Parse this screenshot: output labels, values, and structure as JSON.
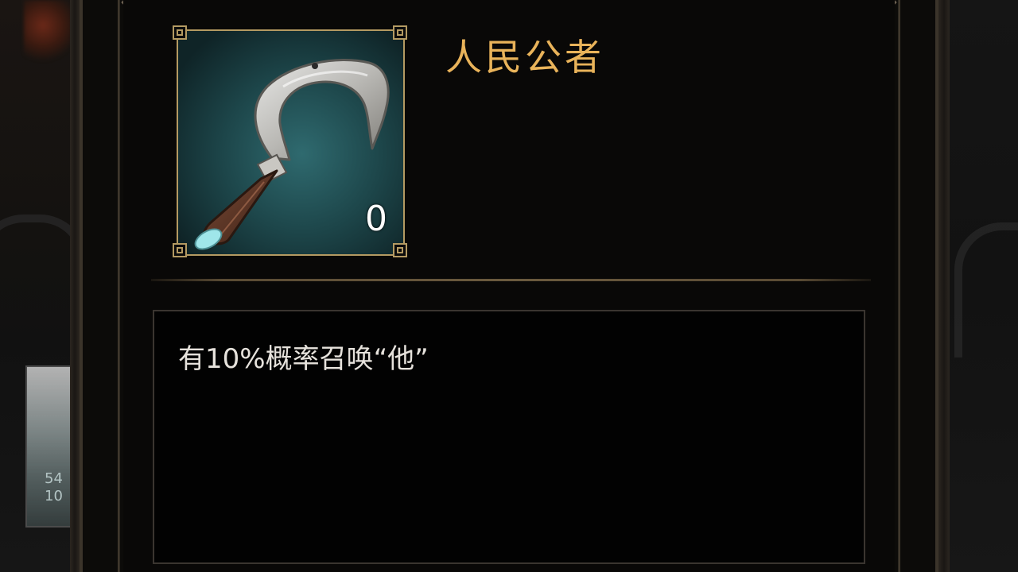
{
  "item": {
    "name": "人民公者",
    "count": "0",
    "description": "有10%概率召唤“他”",
    "icon": "sickle-icon"
  },
  "background": {
    "left_card_count": "54\n10"
  },
  "colors": {
    "name_gold": "#e9b35a",
    "frame_gold": "#b49a62",
    "icon_bg_teal": "#1d464a",
    "description_text": "#e6e2dc"
  }
}
